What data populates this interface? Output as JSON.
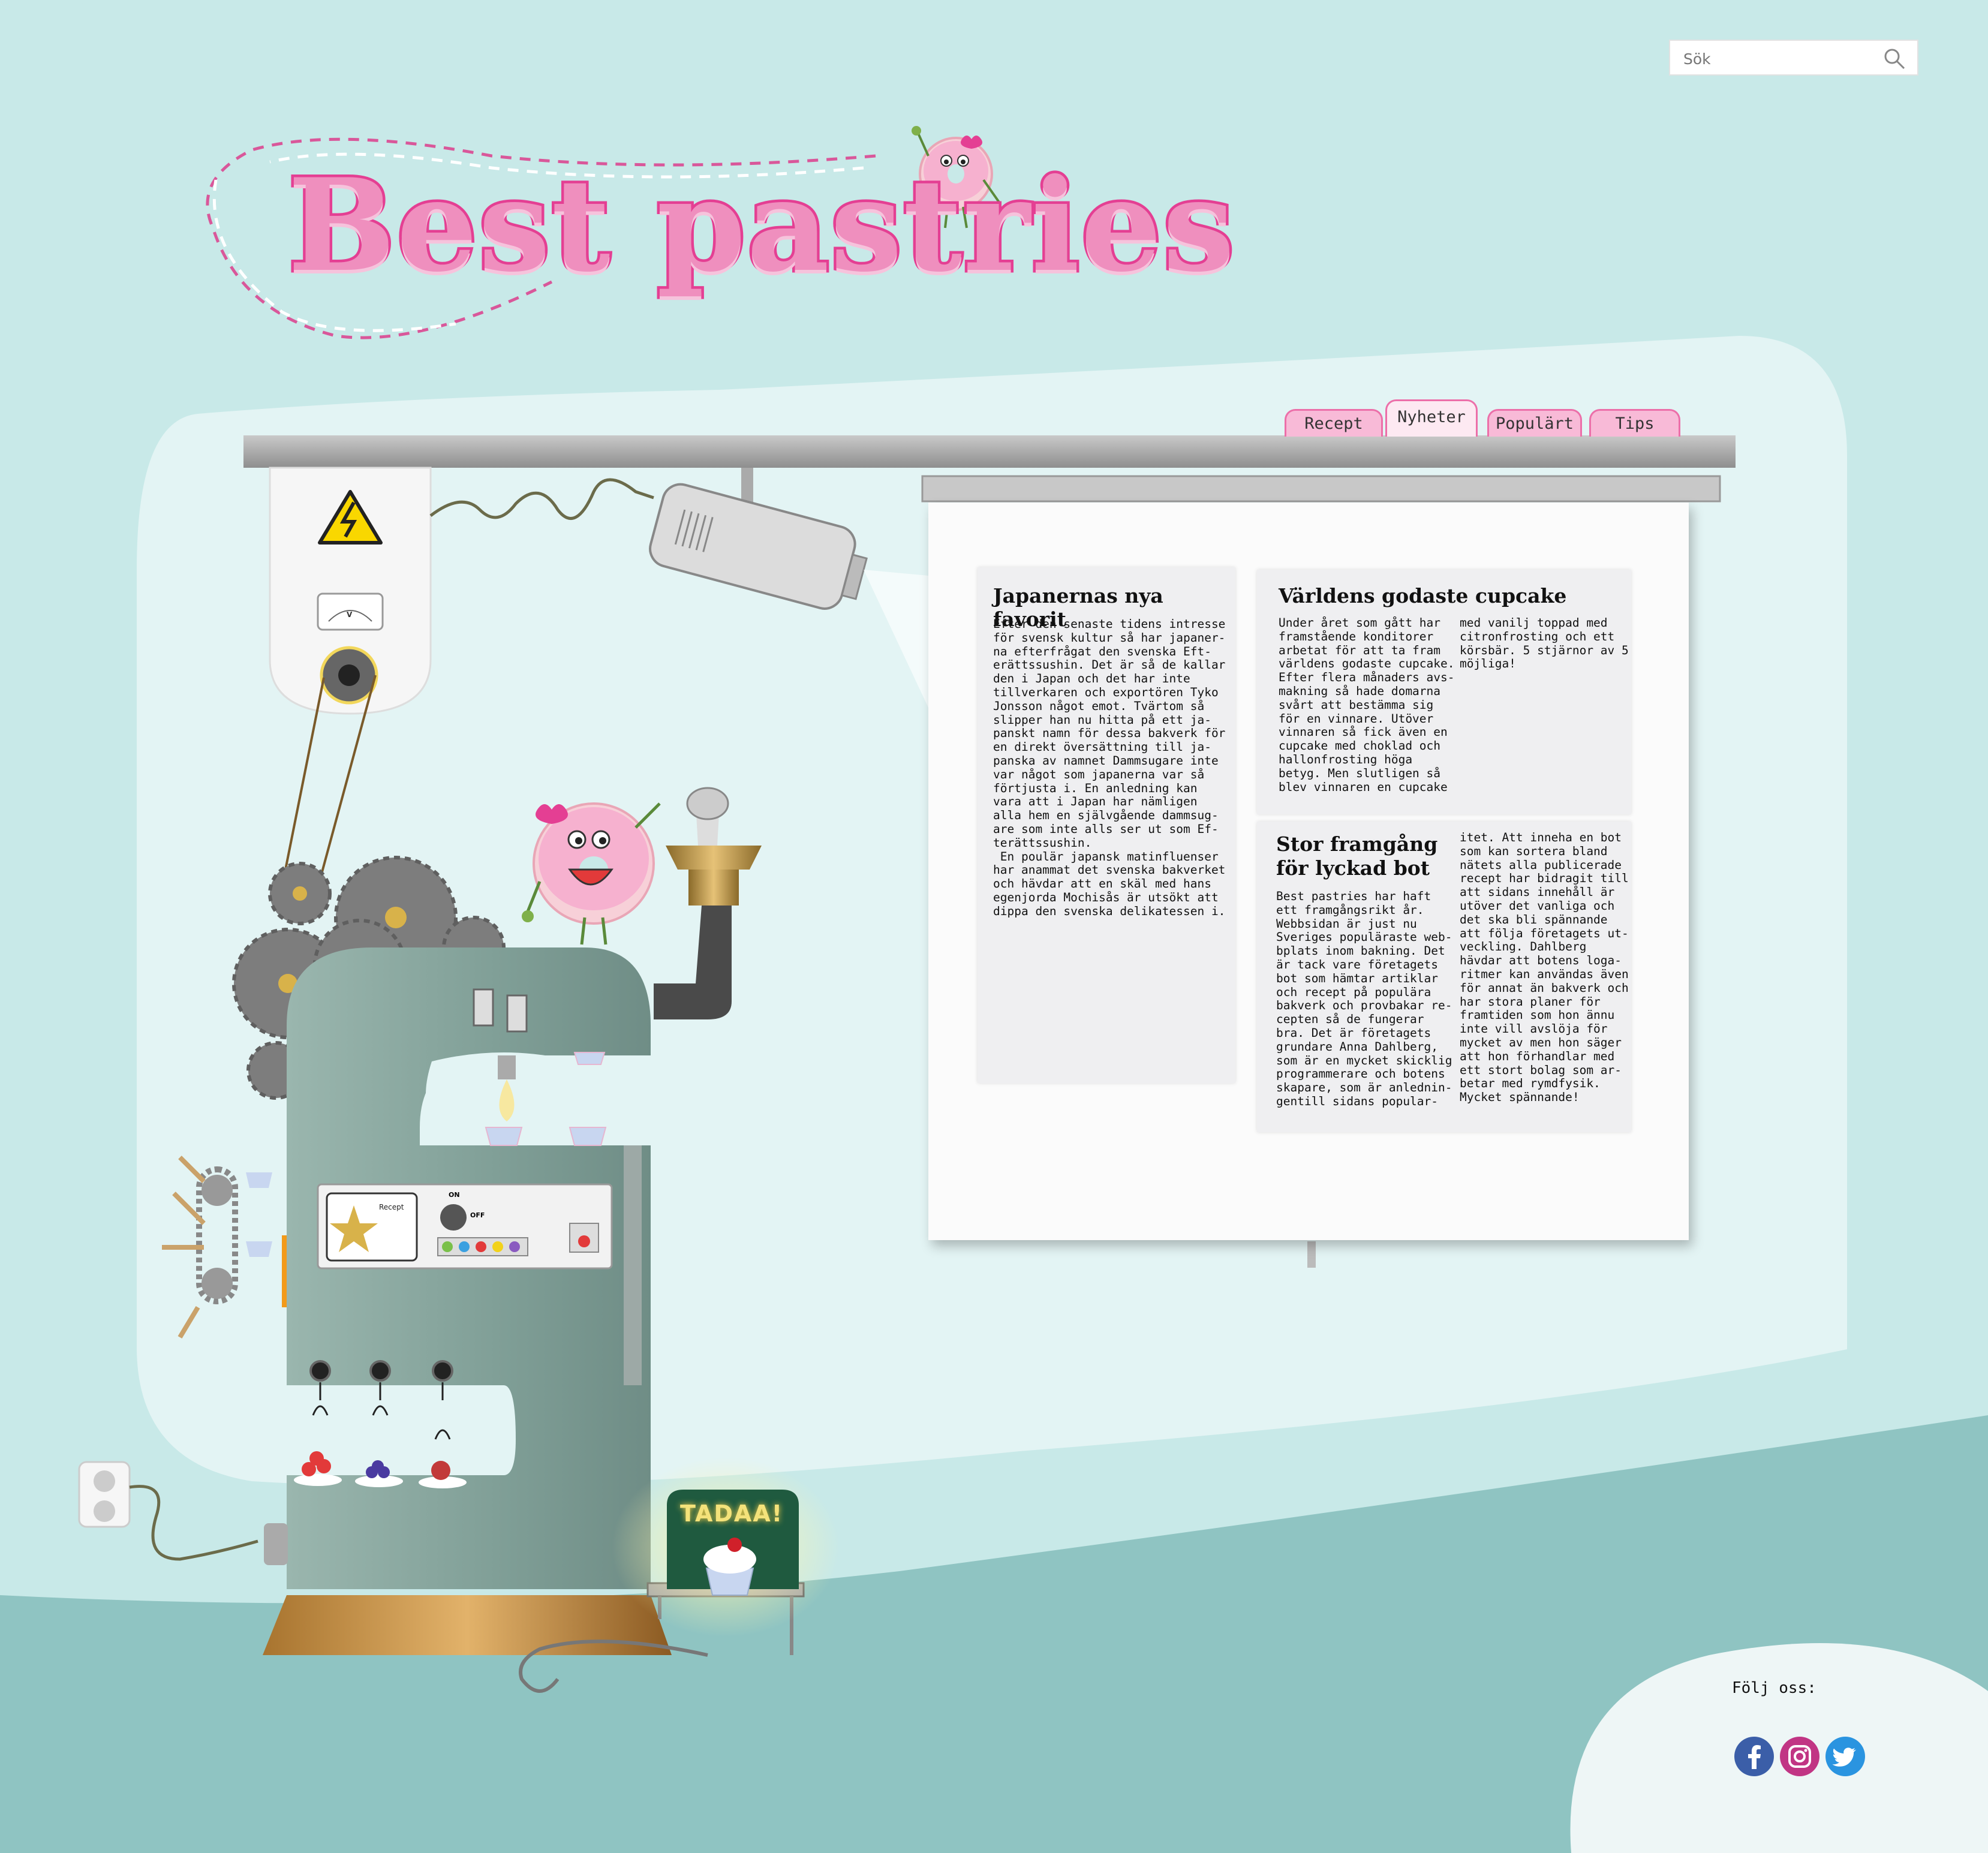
{
  "search": {
    "placeholder": "Sök"
  },
  "logo": {
    "title": "Best pastries"
  },
  "nav": {
    "tabs": [
      {
        "label": "Recept"
      },
      {
        "label": "Nyheter",
        "active": true
      },
      {
        "label": "Populärt"
      },
      {
        "label": "Tips"
      }
    ]
  },
  "articles": {
    "a1": {
      "title": "Japanernas nya favorit",
      "text": "Efter den senaste tidens intresse\nför svensk kultur så har japaner-\nna efterfrågat den svenska Eft-\nerättssushin. Det är så de kallar\nden i Japan och det har inte\ntillverkaren och exportören Tyko\nJonsson något emot. Tvärtom så\nslipper han nu hitta på ett ja-\npanskt namn för dessa bakverk för\nen direkt översättning till ja-\npanska av namnet Dammsugare inte\nvar något som japanerna var så\nförtjusta i. En anledning kan\nvara att i Japan har nämligen\nalla hem en självgående dammsug-\nare som inte alls ser ut som Ef-\nterättssushin.\n En poulär japansk matinfluenser\nhar anammat det svenska bakverket\noch hävdar att en skäl med hans\negenjorda Mochisås är utsökt att\ndippa den svenska delikatessen i."
    },
    "a2": {
      "title": "Världens godaste cupcake",
      "col1": "Under året som gått har\nframstående konditorer\narbetat för att ta fram\nvärldens godaste cupcake.\nEfter flera månaders avs-\nmakning så hade domarna\nsvårt att bestämma sig\nför en vinnare. Utöver\nvinnaren så fick även en\ncupcake med choklad och\nhallonfrosting höga\nbetyg. Men slutligen så\nblev vinnaren en cupcake",
      "col2": "med vanilj toppad med\ncitronfrosting och ett\nkörsbär. 5 stjärnor av 5\nmöjliga!"
    },
    "a3": {
      "title": "Stor framgång\nför lyckad bot",
      "col1": "Best pastries har haft\nett framgångsrikt år.\nWebbsidan är just nu\nSveriges populäraste web-\nbplats inom bakning. Det\när tack vare företagets\nbot som hämtar artiklar\noch recept på populära\nbakverk och provbakar re-\ncepten så de fungerar\nbra. Det är företagets\ngrundare Anna Dahlberg,\nsom är en mycket skicklig\nprogrammerare och botens\nskapare, som är anlednin-\ngentill sidans popular-",
      "col2": "itet. Att inneha en bot\nsom kan sortera bland\nnätets alla publicerade\nrecept har bidragit till\natt sidans innehåll är\nutöver det vanliga och\ndet ska bli spännande\natt följa företagets ut-\nveckling. Dahlberg\nhävdar att botens loga-\nritmer kan användas även\nför annat än bakverk och\nhar stora planer för\nframtiden som hon ännu\ninte vill avslöja för\nmycket av men hon säger\natt hon förhandlar med\nett stort bolag som ar-\nbetar med rymdfysik.\nMycket spännande!"
    }
  },
  "machine": {
    "recipe_card": {
      "title": "Recept"
    },
    "switch": {
      "on": "ON",
      "off": "OFF"
    },
    "sign": "TADAA!",
    "voltmeter_unit": "V"
  },
  "footer": {
    "follow": "Följ oss:"
  },
  "social": [
    "facebook-icon",
    "instagram-icon",
    "twitter-icon"
  ],
  "colors": {
    "background": "#c8e9e8",
    "panel": "#e3f4f4",
    "pink": "#ef8fbe",
    "pink_dark": "#e43f93",
    "bottom_band": "#8fc4c2",
    "machine": "#8aa8a1"
  }
}
